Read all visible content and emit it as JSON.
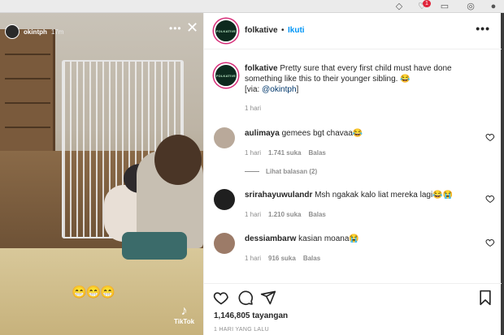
{
  "browser": {
    "notification_count": "1"
  },
  "video": {
    "username": "okintph",
    "time": "17m",
    "more_icon": "more-horizontal-icon",
    "close_icon": "close-icon",
    "emoji_caption": "😁😁😁",
    "watermark": "TikTok"
  },
  "post": {
    "username": "folkative",
    "separator": "•",
    "follow_label": "Ikuti",
    "avatar_text": "FOLKATIVE",
    "caption": {
      "username": "folkative",
      "text": "Pretty sure that every first child must have done something like this to their younger sibling. 😂",
      "via_prefix": "[via: ",
      "via_handle": "@okintph",
      "via_suffix": "]",
      "time": "1 hari"
    },
    "comments": [
      {
        "username": "aulimaya",
        "text": "gemees bgt chavaa😂",
        "time": "1 hari",
        "likes": "1.741 suka",
        "reply": "Balas",
        "avatar_color": "#b9a99a"
      },
      {
        "username": "srirahayuwulandr",
        "text": "Msh ngakak kalo liat mereka lagi😂😭",
        "time": "1 hari",
        "likes": "1.210 suka",
        "reply": "Balas",
        "avatar_color": "#1f1f1f"
      },
      {
        "username": "dessiambarw",
        "text": "kasian moana😭",
        "time": "1 hari",
        "likes": "916 suka",
        "reply": "Balas",
        "avatar_color": "#9c7b68"
      }
    ],
    "view_replies": "Lihat balasan (2)",
    "views": "1,146,805 tayangan",
    "posted_ago": "1 HARI YANG LALU"
  },
  "colors": {
    "link_blue": "#0095f6",
    "text": "#262626",
    "muted": "#8e8e8e"
  }
}
